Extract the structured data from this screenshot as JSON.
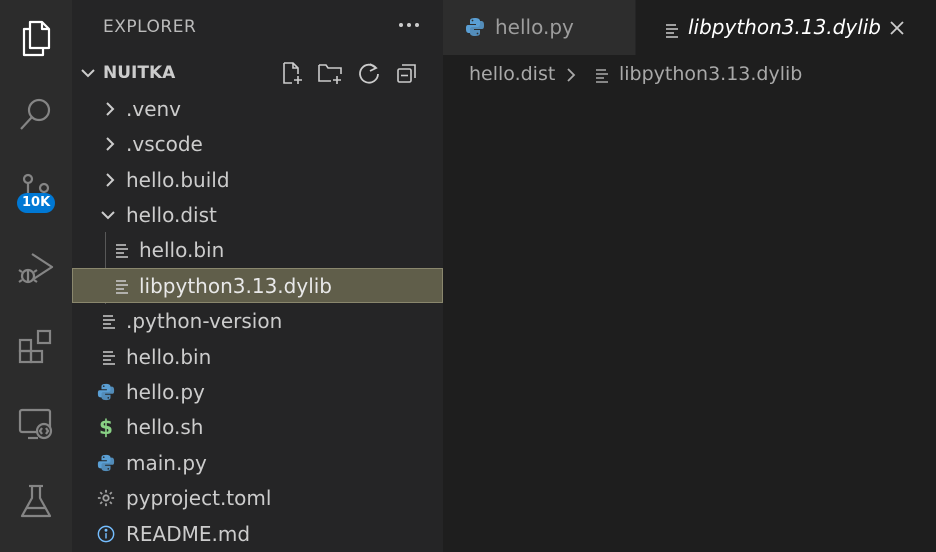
{
  "activity_bar": {
    "items": [
      {
        "icon": "files-icon",
        "active": true
      },
      {
        "icon": "search-icon"
      },
      {
        "icon": "source-control-icon",
        "badge": "10K"
      },
      {
        "icon": "run-debug-icon"
      },
      {
        "icon": "extensions-icon"
      },
      {
        "icon": "remote-explorer-icon"
      },
      {
        "icon": "testing-icon"
      }
    ]
  },
  "sidebar": {
    "title": "EXPLORER",
    "more_icon": "ellipsis-icon",
    "section": {
      "title": "NUITKA",
      "actions": [
        "new-file-icon",
        "new-folder-icon",
        "refresh-icon",
        "collapse-all-icon"
      ]
    },
    "tree": [
      {
        "label": ".venv",
        "type": "folder",
        "expanded": false
      },
      {
        "label": ".vscode",
        "type": "folder",
        "expanded": false
      },
      {
        "label": "hello.build",
        "type": "folder",
        "expanded": false
      },
      {
        "label": "hello.dist",
        "type": "folder",
        "expanded": true
      },
      {
        "label": "hello.bin",
        "type": "file",
        "icon": "lines-icon"
      },
      {
        "label": "libpython3.13.dylib",
        "type": "file",
        "icon": "lines-icon",
        "selected": true
      },
      {
        "label": ".python-version",
        "type": "file",
        "icon": "lines-icon"
      },
      {
        "label": "hello.bin",
        "type": "file",
        "icon": "lines-icon"
      },
      {
        "label": "hello.py",
        "type": "file",
        "icon": "python-icon"
      },
      {
        "label": "hello.sh",
        "type": "file",
        "icon": "dollar-icon"
      },
      {
        "label": "main.py",
        "type": "file",
        "icon": "python-icon"
      },
      {
        "label": "pyproject.toml",
        "type": "file",
        "icon": "gear-icon"
      },
      {
        "label": "README.md",
        "type": "file",
        "icon": "info-icon"
      }
    ]
  },
  "tabs": [
    {
      "label": "hello.py",
      "icon": "python-icon",
      "active": false
    },
    {
      "label": "libpython3.13.dylib",
      "icon": "lines-icon",
      "active": true,
      "close_icon": "close-icon"
    }
  ],
  "breadcrumb": {
    "folder": "hello.dist",
    "separator_icon": "chevron-right-icon",
    "file_icon": "lines-icon",
    "file": "libpython3.13.dylib"
  },
  "colors": {
    "accent_badge": "#0078d4",
    "selection": "#605e4a",
    "python_blue": "#5a9fd4",
    "python_yellow": "#ffd43b",
    "shell_green": "#89d185",
    "info_blue": "#75beff"
  }
}
